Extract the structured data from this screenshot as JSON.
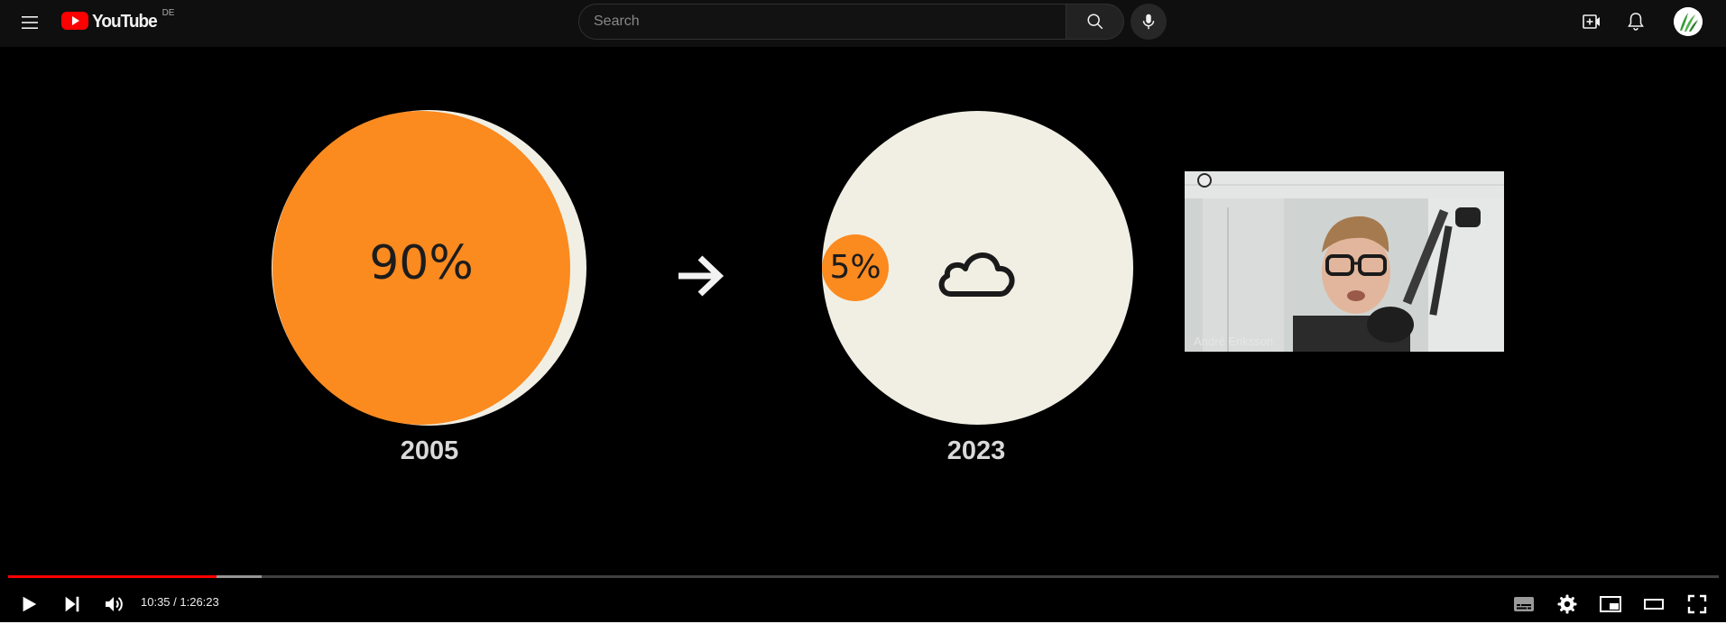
{
  "header": {
    "logo_text": "YouTube",
    "country_code": "DE",
    "search_placeholder": "Search",
    "icons": [
      "menu-icon",
      "search-icon",
      "mic-icon",
      "create-icon",
      "bell-icon",
      "avatar"
    ]
  },
  "video": {
    "slide": {
      "left_value": "90%",
      "left_year": "2005",
      "right_value": "5%",
      "right_year": "2023"
    },
    "webcam_name": "André Eriksson"
  },
  "player": {
    "current_time": "10:35",
    "duration": "1:26:23",
    "time_display": "10:35 / 1:26:23",
    "played_fraction": 0.122,
    "buffered_fraction": 0.148
  },
  "colors": {
    "accent": "#ff0000",
    "slide_orange": "#fb8a1f",
    "slide_cream": "#f1efe3"
  }
}
